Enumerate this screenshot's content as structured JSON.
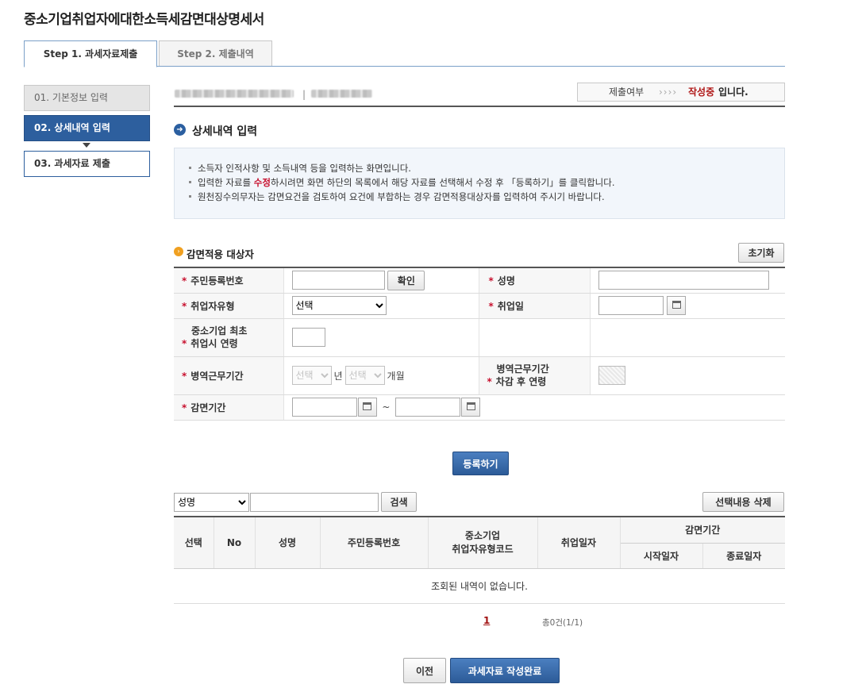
{
  "page": {
    "title": "중소기업취업자에대한소득세감면대상명세서"
  },
  "steps": [
    {
      "label": "Step 1. 과세자료제출",
      "active": true
    },
    {
      "label": "Step 2. 제출내역",
      "active": false
    }
  ],
  "nav": [
    {
      "label": "01. 기본정보 입력",
      "state": "done"
    },
    {
      "label": "02. 상세내역 입력",
      "state": "current"
    },
    {
      "label": "03. 과세자료 제출",
      "state": "next"
    }
  ],
  "status": {
    "label": "제출여부",
    "arrows": "››››",
    "value": "작성중",
    "suffix": "입니다."
  },
  "section": {
    "title": "상세내역 입력"
  },
  "notice": [
    {
      "text": "소득자 인적사항 및 소득내역 등을 입력하는 화면입니다."
    },
    {
      "pre": "입력한 자료를 ",
      "hl": "수정",
      "post": "하시려면 화면 하단의 목록에서 해당 자료를 선택해서 수정 후 「등록하기」를 클릭합니다."
    },
    {
      "text": "원천징수의무자는 감면요건을 검토하여 요건에 부합하는 경우 감면적용대상자를 입력하여 주시기 바랍니다."
    }
  ],
  "form": {
    "title": "감면적용 대상자",
    "reset_label": "초기화",
    "req_mark": "*",
    "jumin_label": "주민등록번호",
    "confirm_label": "확인",
    "name_label": "성명",
    "emp_type_label": "취업자유형",
    "emp_type_value": "선택",
    "emp_date_label": "취업일",
    "age_label_1": "중소기업 최초",
    "age_label_2": "취업시 연령",
    "military_label": "병역근무기간",
    "military_year_value": "선택",
    "year_unit": "년",
    "military_month_value": "선택",
    "month_unit": "개월",
    "age_after_label_1": "병역근무기간",
    "age_after_label_2": "차감 후 연령",
    "period_label": "감면기간",
    "tilde": "~"
  },
  "register_label": "등록하기",
  "search": {
    "field_value": "성명",
    "button_label": "검색",
    "delete_label": "선택내용 삭제"
  },
  "list": {
    "headers": {
      "select": "선택",
      "no": "No",
      "name": "성명",
      "jumin": "주민등록번호",
      "type_1": "중소기업",
      "type_2": "취업자유형코드",
      "date": "취업일자",
      "period": "감면기간",
      "start": "시작일자",
      "end": "종료일자"
    },
    "empty": "조회된 내역이 없습니다."
  },
  "pagination": {
    "current": "1",
    "info": "총0건(1/1)"
  },
  "footer": {
    "prev_label": "이전",
    "complete_label": "과세자료 작성완료"
  }
}
